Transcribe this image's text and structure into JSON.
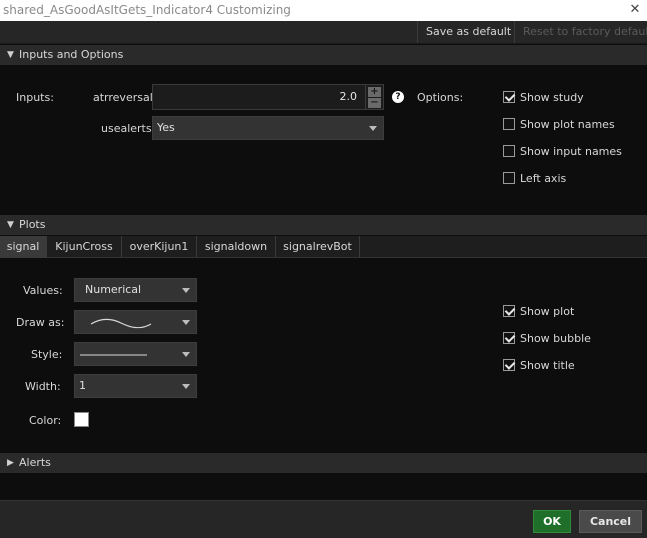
{
  "window": {
    "title": "shared_AsGoodAsItGets_Indicator4 Customizing",
    "close_glyph": "✕"
  },
  "toolbar": {
    "save_default": "Save as default",
    "reset_factory": "Reset to factory default"
  },
  "inputs_section": {
    "header": "Inputs and Options",
    "inputs_label": "Inputs:",
    "atrreversal": {
      "label": "atrreversal",
      "value": "2.0"
    },
    "usealerts": {
      "label": "usealerts",
      "value": "Yes"
    },
    "help_glyph": "?"
  },
  "options": {
    "label": "Options:",
    "items": [
      {
        "label": "Show study",
        "checked": true
      },
      {
        "label": "Show plot names",
        "checked": false
      },
      {
        "label": "Show input names",
        "checked": false
      },
      {
        "label": "Left axis",
        "checked": false
      }
    ]
  },
  "plots_section": {
    "header": "Plots",
    "tabs": [
      "signal",
      "KijunCross",
      "overKijun1",
      "signaldown",
      "signalrevBot"
    ],
    "active_tab": "signal",
    "values": {
      "label": "Values:",
      "value": "Numerical"
    },
    "draw_as": {
      "label": "Draw as:"
    },
    "style": {
      "label": "Style:"
    },
    "width": {
      "label": "Width:",
      "value": "1"
    },
    "color": {
      "label": "Color:",
      "value": "#ffffff"
    },
    "checks": [
      {
        "label": "Show plot",
        "checked": true
      },
      {
        "label": "Show bubble",
        "checked": true
      },
      {
        "label": "Show title",
        "checked": true
      }
    ]
  },
  "alerts_section": {
    "header": "Alerts"
  },
  "footer": {
    "ok": "OK",
    "cancel": "Cancel"
  },
  "colors": {
    "ok_green": "#1f6f2a",
    "background": "#0d0d0d",
    "section_header": "#2a2a2a"
  }
}
